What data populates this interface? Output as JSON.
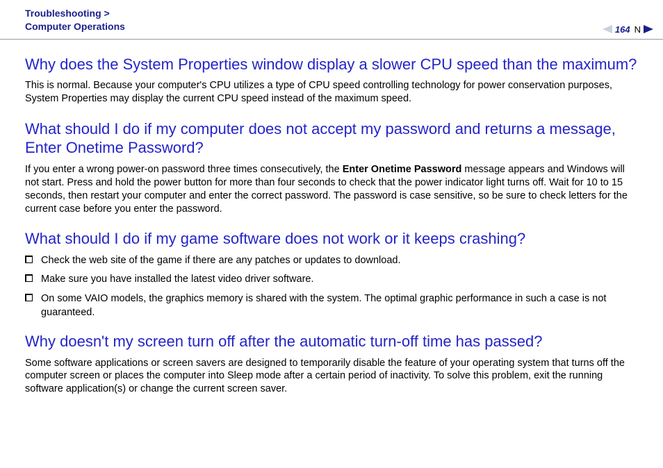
{
  "header": {
    "breadcrumb_line1": "Troubleshooting >",
    "breadcrumb_line2": "Computer Operations",
    "page_number": "164",
    "n_label": "N"
  },
  "sections": {
    "q1": {
      "heading": "Why does the System Properties window display a slower CPU speed than the maximum?",
      "body": "This is normal. Because your computer's CPU utilizes a type of CPU speed controlling technology for power conservation purposes, System Properties may display the current CPU speed instead of the maximum speed."
    },
    "q2": {
      "heading": "What should I do if my computer does not accept my password and returns a message, Enter Onetime Password?",
      "body_pre": "If you enter a wrong power-on password three times consecutively, the ",
      "body_bold": "Enter Onetime Password",
      "body_post": " message appears and Windows will not start. Press and hold the power button for more than four seconds to check that the power indicator light turns off. Wait for 10 to 15 seconds, then restart your computer and enter the correct password. The password is case sensitive, so be sure to check letters for the current case before you enter the password."
    },
    "q3": {
      "heading": "What should I do if my game software does not work or it keeps crashing?",
      "bullets": [
        "Check the web site of the game if there are any patches or updates to download.",
        "Make sure you have installed the latest video driver software.",
        "On some VAIO models, the graphics memory is shared with the system. The optimal graphic performance in such a case is not guaranteed."
      ]
    },
    "q4": {
      "heading": "Why doesn't my screen turn off after the automatic turn-off time has passed?",
      "body": "Some software applications or screen savers are designed to temporarily disable the feature of your operating system that turns off the computer screen or places the computer into Sleep mode after a certain period of inactivity. To solve this problem, exit the running software application(s) or change the current screen saver."
    }
  }
}
